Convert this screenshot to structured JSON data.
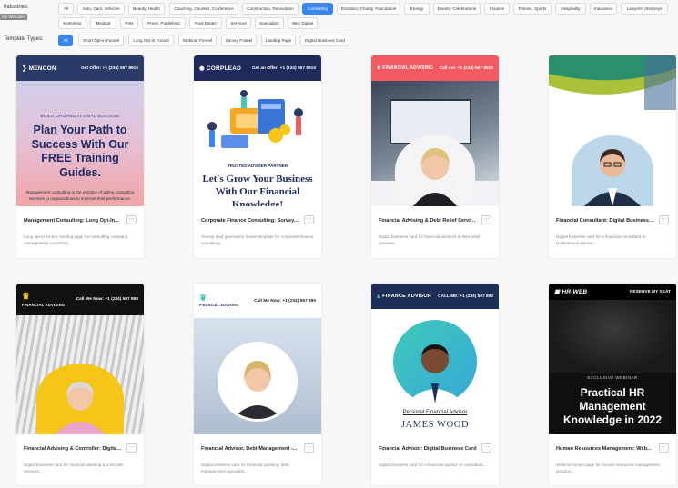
{
  "filters": {
    "industries_label": "Industries:",
    "tooltip": "My Websites",
    "industries": [
      {
        "label": "All",
        "active": false
      },
      {
        "label": "Auto, Cars, Vehicles",
        "active": false
      },
      {
        "label": "Beauty, Health",
        "active": false
      },
      {
        "label": "Coaching, Courses, Conference",
        "active": false
      },
      {
        "label": "Construction, Renovation",
        "active": false
      },
      {
        "label": "Consulting",
        "active": true
      },
      {
        "label": "Donation, Charity, Foundation",
        "active": false
      },
      {
        "label": "Energy",
        "active": false
      },
      {
        "label": "Events, Celebrations",
        "active": false
      },
      {
        "label": "Finance",
        "active": false
      },
      {
        "label": "Fitness, Sports",
        "active": false
      },
      {
        "label": "Hospitality",
        "active": false
      },
      {
        "label": "Insurance",
        "active": false
      },
      {
        "label": "Lawyers, Attorneys",
        "active": false
      },
      {
        "label": "Marketing",
        "active": false
      },
      {
        "label": "Medical",
        "active": false
      },
      {
        "label": "Pets",
        "active": false
      },
      {
        "label": "Press, Publishing",
        "active": false
      },
      {
        "label": "Real Estate",
        "active": false
      },
      {
        "label": "Services",
        "active": false
      },
      {
        "label": "Specialists",
        "active": false
      },
      {
        "label": "Web Digital",
        "active": false
      }
    ],
    "types_label": "Template Types:",
    "types": [
      {
        "label": "All",
        "active": true
      },
      {
        "label": "Short Opt-in Funnel",
        "active": false
      },
      {
        "label": "Long Opt-in Funnel",
        "active": false
      },
      {
        "label": "Webinar Funnel",
        "active": false
      },
      {
        "label": "Survey Funnel",
        "active": false
      },
      {
        "label": "Landing Page",
        "active": false
      },
      {
        "label": "Digital Business Card",
        "active": false
      }
    ]
  },
  "cards": [
    {
      "title": "Management Consulting: Long Opt-In...",
      "desc": "Long opt-in funnel, landing page for consulting company, management consulting...",
      "thumb": {
        "logo": "MENCON",
        "phone": "Get Offer: +1 (234) 567 8910",
        "tag": "BUILD ORGANIZATIONAL SUCCESS",
        "headline": "Plan Your Path to Success With Our FREE Training Guides.",
        "body": "Management consulting is the practice of aiding consulting services to organizations to improve their performance."
      }
    },
    {
      "title": "Corporate Finance Consulting: Survey...",
      "desc": "Survey lead generation funnel template for corporate finance consulting...",
      "thumb": {
        "logo": "CORPLEAD",
        "phone": "Get an Offer: +1 (234) 567 8910",
        "tag": "TRUSTED ADVISER PARTNER",
        "headline": "Let's Grow Your Business With Our Financial Knowledge!"
      }
    },
    {
      "title": "Financial Advising & Debt Relief Servic...",
      "desc": "Digital business card for financial advisors & debt relief services...",
      "thumb": {
        "logo": "FINANCIAL ADVISING",
        "phone": "Call me: +1 (234) 567 8910"
      }
    },
    {
      "title": "Financial Consultant: Digital Business ...",
      "desc": "Digital business card for a financial consultant or professional advisor...",
      "thumb": {}
    },
    {
      "title": "Financial Advising & Controller: Digital ...",
      "desc": "Digital business card for financial advising & controller services...",
      "thumb": {
        "logo": "FINANCIAL ADVISING",
        "phone": "Call We Now: +1 (234) 567 890"
      }
    },
    {
      "title": "Financial Advisor, Debt Management -...",
      "desc": "Digital business card for financial advising, debt management specialist...",
      "thumb": {
        "logo": "FINANCIAL ADVISING",
        "phone": "Call Me Now: +1 (234) 567 890"
      }
    },
    {
      "title": "Financial Advisor: Digital Business Card",
      "desc": "Digital business card for a financial advisor or consultant...",
      "thumb": {
        "logo": "FINANCE ADVISOR",
        "phone": "CALL ME: +1 (234) 567 890",
        "role": "Personal Financial Advisor",
        "name": "JAMES WOOD"
      }
    },
    {
      "title": "Human Resources Management: Web...",
      "desc": "Webinar funnel page for human resources management practice...",
      "thumb": {
        "logo": "HR-WEB",
        "phone": "RESERVE MY SEAT",
        "tag": "EXCLUSIVE WEBINAR",
        "headline": "Practical HR Management Knowledge in 2022"
      }
    }
  ]
}
